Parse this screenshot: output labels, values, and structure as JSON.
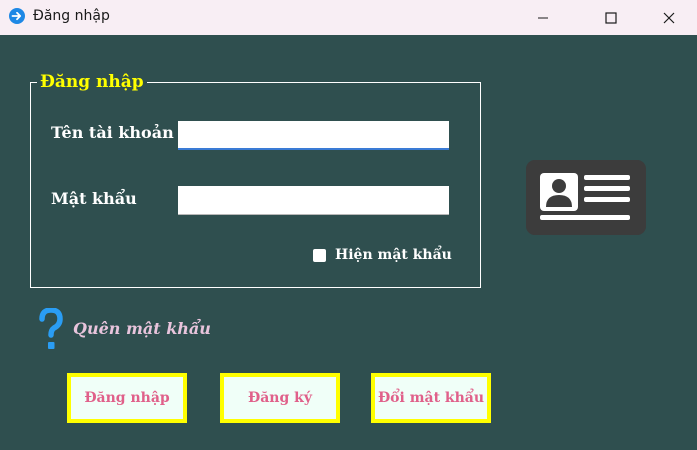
{
  "window": {
    "title": "Đăng nhập",
    "controls": [
      "minimize-icon",
      "maximize-icon",
      "close-icon"
    ]
  },
  "login_group": {
    "legend": "Đăng nhập",
    "username_label": "Tên tài khoản",
    "username_value": "",
    "password_label": "Mật khẩu",
    "password_value": "",
    "show_password_label": "Hiện mật khẩu",
    "show_password_checked": false
  },
  "side_icon": "id-card-icon",
  "forgot": {
    "icon": "question-icon",
    "label": "Quên mật khẩu"
  },
  "buttons": {
    "login": "Đăng nhập",
    "register": "Đăng ký",
    "change_password": "Đổi mật khẩu"
  },
  "colors": {
    "background": "#2f4f4f",
    "legend": "#ffff00",
    "button_border": "#ffff00",
    "button_text": "#e0608a",
    "button_bg": "#f0fff8",
    "forgot_text": "#e8c4dc",
    "question_icon": "#2a9df4",
    "titlebar": "#f8eef4"
  }
}
